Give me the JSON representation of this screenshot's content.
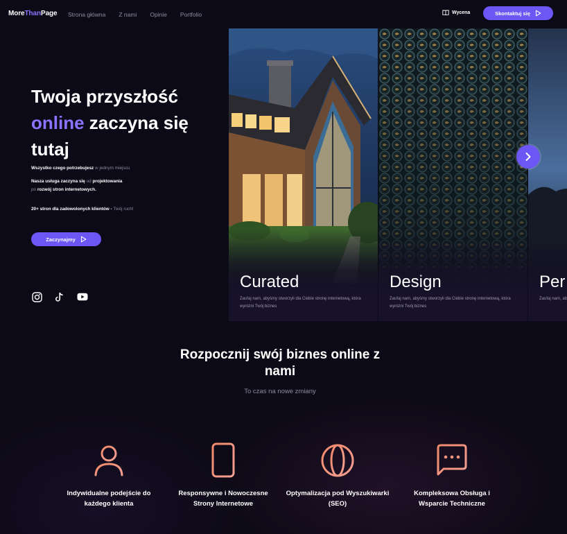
{
  "header": {
    "logo": {
      "part1": "More",
      "part2": "Than",
      "part3": "Page"
    },
    "nav": [
      "Strona główna",
      "Z nami",
      "Opinie",
      "Portfolio"
    ],
    "quote_label": "Wycena",
    "contact_label": "Skontaktuj się"
  },
  "hero": {
    "title_line1": "Twoja przyszłość",
    "title_accent": "online",
    "title_line2_rest": " zaczyna się",
    "title_line3": "tutaj",
    "line1_strong": "Wszystko czego potrzebujesz",
    "line1_muted": " w jednym miejscu",
    "line2_a": "Nasza usługa zaczyna się",
    "line2_b": " od ",
    "line2_c": "projektowania",
    "line3_a": "po ",
    "line3_b": "rozwój stron internetowych.",
    "line4_strong": "20+ stron dla zadowolonych klientów - ",
    "line4_muted": "Twój ruch!",
    "cta_label": "Zaczynajmy",
    "socials": [
      "instagram-icon",
      "tiktok-icon",
      "youtube-icon"
    ]
  },
  "cards": [
    {
      "title": "Curated",
      "desc": "Zaufaj nam, abyśmy stworzyli dla Ciebie stronę internetową, która wyróżni Twój biznes"
    },
    {
      "title": "Design",
      "desc": "Zaufaj nam, abyśmy stworzyli dla Ciebie stronę internetową, która wyróżni Twój biznes"
    },
    {
      "title": "Per",
      "desc": "Zaufaj nam, abyśmy stworzyli dla Ciebie stronę internetową"
    }
  ],
  "section": {
    "title": "Rozpocznij swój biznes online z nami",
    "subtitle": "To czas na nowe zmiany",
    "features": [
      {
        "icon": "user-icon",
        "label": "Indywidualne podejście do każdego klienta"
      },
      {
        "icon": "smartphone-icon",
        "label": "Responsywne i Nowoczesne Strony Internetowe"
      },
      {
        "icon": "globe-icon",
        "label": "Optymalizacja pod Wyszukiwarki (SEO)"
      },
      {
        "icon": "chat-icon",
        "label": "Kompleksowa Obsługa i Wsparcie Techniczne"
      }
    ]
  },
  "colors": {
    "accent": "#6c56f5",
    "accent_text": "#8a74ff",
    "background": "#0d0a17",
    "icon_gradient": [
      "#f08a6a",
      "#f5a093"
    ]
  }
}
